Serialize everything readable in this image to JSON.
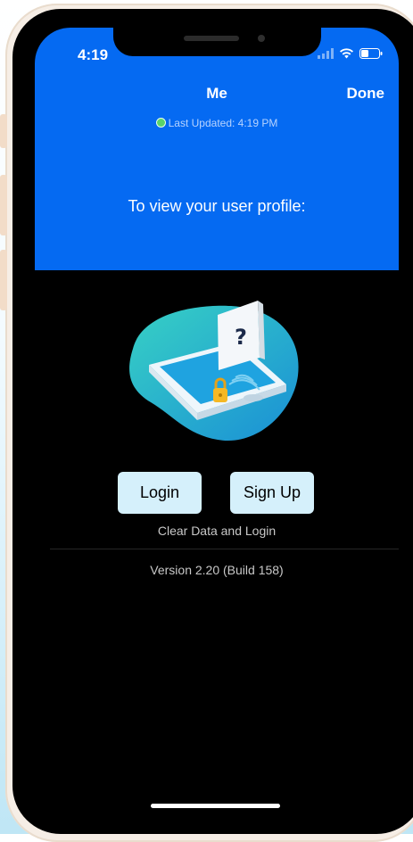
{
  "status_bar": {
    "time": "4:19"
  },
  "nav": {
    "title": "Me",
    "done_label": "Done"
  },
  "sync": {
    "last_updated": "Last Updated: 4:19 PM"
  },
  "prompt": {
    "text": "To view your user profile:"
  },
  "illustration": {
    "icon": "secure-phone-illustration",
    "glyph": "?"
  },
  "actions": {
    "login_label": "Login",
    "signup_label": "Sign Up",
    "clear_label": "Clear Data and Login"
  },
  "footer": {
    "version": "Version 2.20 (Build 158)"
  },
  "colors": {
    "header_bg": "#056af2",
    "button_bg": "#d5f0fb",
    "screen_bg": "#000000"
  }
}
